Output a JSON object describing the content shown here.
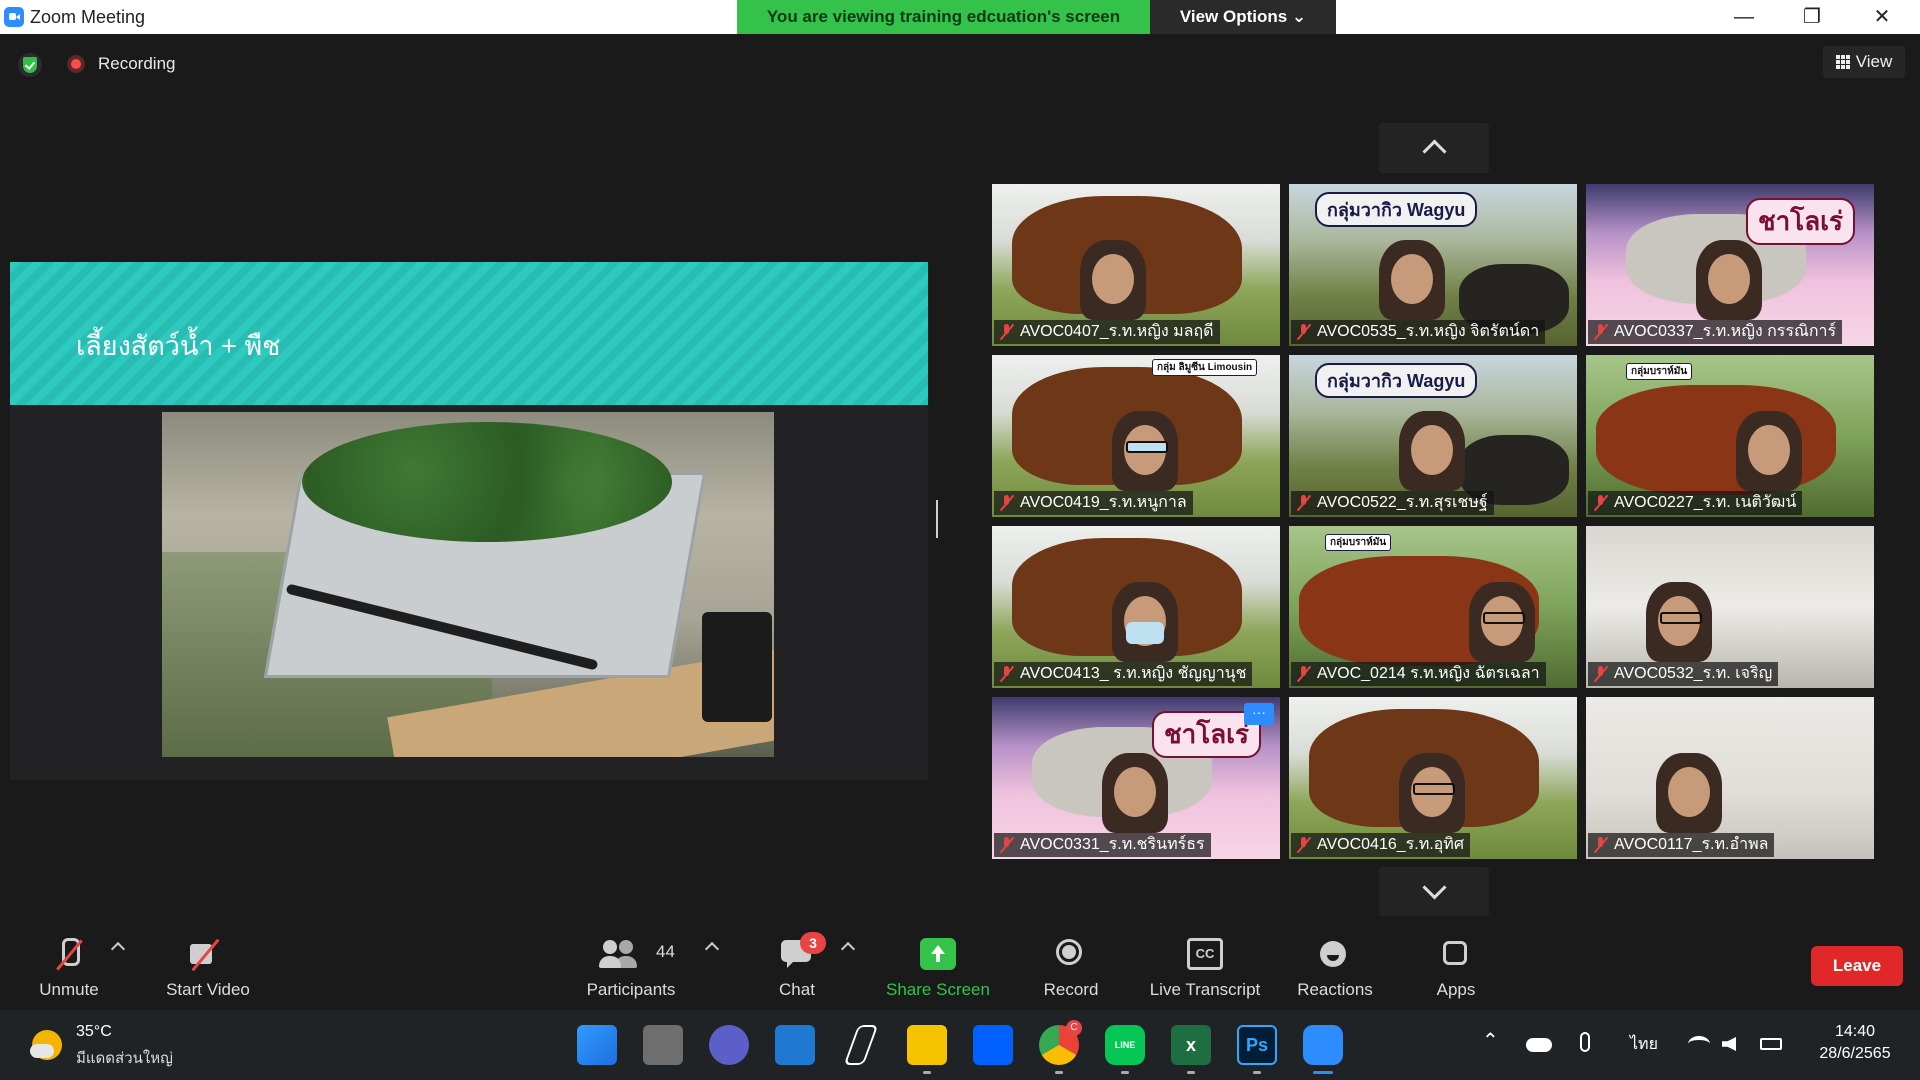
{
  "window": {
    "title": "Zoom Meeting",
    "banner": "You are viewing training edcuation's screen",
    "view_options": "View Options ⌄",
    "min": "—",
    "max": "❐",
    "close": "✕"
  },
  "topbar": {
    "recording": "Recording",
    "view": "View"
  },
  "shared_slide": {
    "title": "เลี้ยงสัตว์น้ำ + พืช"
  },
  "gallery": {
    "tiles": [
      {
        "name": "AVOC0407_ร.ท.หญิง มลฤดี"
      },
      {
        "name": "AVOC0535_ร.ท.หญิง จิตรัตน์ดา",
        "sign": "กลุ่มวากิว Wagyu"
      },
      {
        "name": "AVOC0337_ร.ท.หญิง กรรณิการ์",
        "sign": "ชาโลเร่"
      },
      {
        "name": "AVOC0419_ร.ท.หนูกาล",
        "sign": "กลุ่ม ลิมูซีน Limousin"
      },
      {
        "name": "AVOC0522_ร.ท.สุรเชษฐ์",
        "sign": "กลุ่มวากิว Wagyu"
      },
      {
        "name": "AVOC0227_ร.ท. เนติวัฒน์",
        "sign": "กลุ่มบราห์มัน"
      },
      {
        "name": "AVOC0413_ ร.ท.หญิง ชัญญานุช"
      },
      {
        "name": "AVOC_0214 ร.ท.หญิง ฉัตรเฉลา",
        "sign": "กลุ่มบราห์มัน"
      },
      {
        "name": "AVOC0532_ร.ท. เจริญ"
      },
      {
        "name": "AVOC0331_ร.ท.ชรินทร์ธร",
        "sign": "ชาโลเร่",
        "more": "···"
      },
      {
        "name": "AVOC0416_ร.ท.อุทิศ"
      },
      {
        "name": "AVOC0117_ร.ท.อำพล"
      }
    ]
  },
  "controls": {
    "unmute": "Unmute",
    "start_video": "Start Video",
    "participants": "Participants",
    "participants_count": "44",
    "chat": "Chat",
    "chat_badge": "3",
    "share_screen": "Share Screen",
    "record": "Record",
    "live_transcript": "Live Transcript",
    "cc": "CC",
    "reactions": "Reactions",
    "apps": "Apps",
    "leave": "Leave"
  },
  "taskbar": {
    "temperature": "35°C",
    "weather": "มีแดดส่วนใหญ่",
    "language": "ไทย",
    "time": "14:40",
    "date": "28/6/2565",
    "chrome_badge": "C",
    "ps_label": "Ps",
    "excel_label": "x",
    "line_label": "LINE"
  },
  "colors": {
    "accent_green": "#35c24b",
    "zoom_blue": "#2d8cff",
    "leave_red": "#e02828",
    "slide_teal": "#2ecac0"
  }
}
